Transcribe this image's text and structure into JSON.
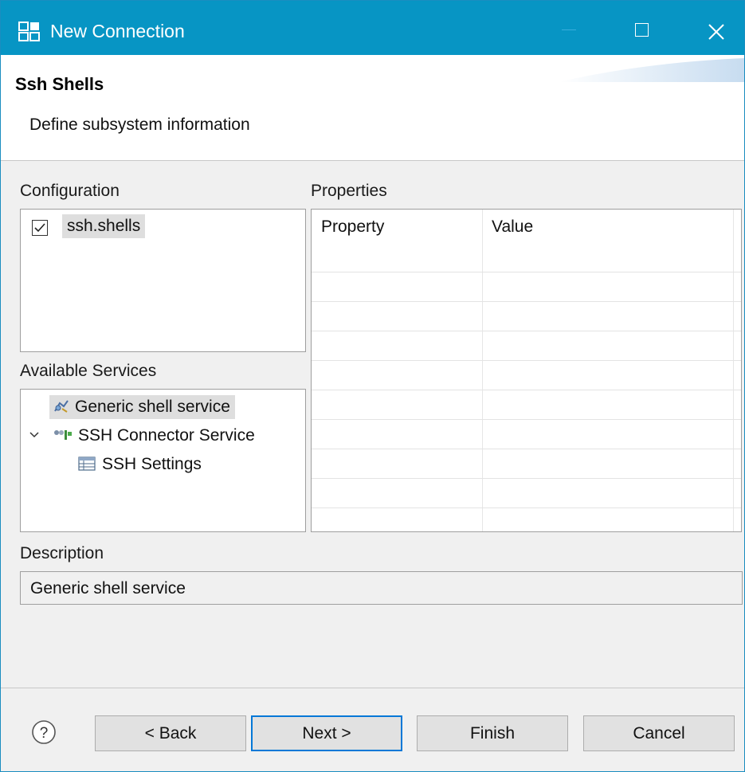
{
  "window": {
    "title": "New Connection",
    "titlebar_color": "#0795c4",
    "icons": [
      "app-icon",
      "minimize-icon",
      "maximize-icon",
      "close-icon"
    ]
  },
  "header": {
    "title": "Ssh Shells",
    "description": "Define subsystem information"
  },
  "configuration": {
    "label": "Configuration",
    "items": [
      {
        "label": "ssh.shells",
        "checked": true,
        "selected": true
      }
    ]
  },
  "available_services": {
    "label": "Available Services",
    "items": [
      {
        "label": "Generic shell service",
        "icon": "shell-service-icon",
        "selected": true
      },
      {
        "label": "SSH Connector Service",
        "icon": "connector-icon",
        "expanded": true
      },
      {
        "label": "SSH Settings",
        "icon": "table-icon",
        "indent": 1
      }
    ]
  },
  "properties": {
    "label": "Properties",
    "columns": [
      "Property",
      "Value"
    ]
  },
  "description": {
    "label": "Description",
    "value": "Generic shell service"
  },
  "footer": {
    "help_icon": "help-icon",
    "back_label": "< Back",
    "next_label": "Next >",
    "finish_label": "Finish",
    "cancel_label": "Cancel",
    "accent": "#0078d7"
  }
}
